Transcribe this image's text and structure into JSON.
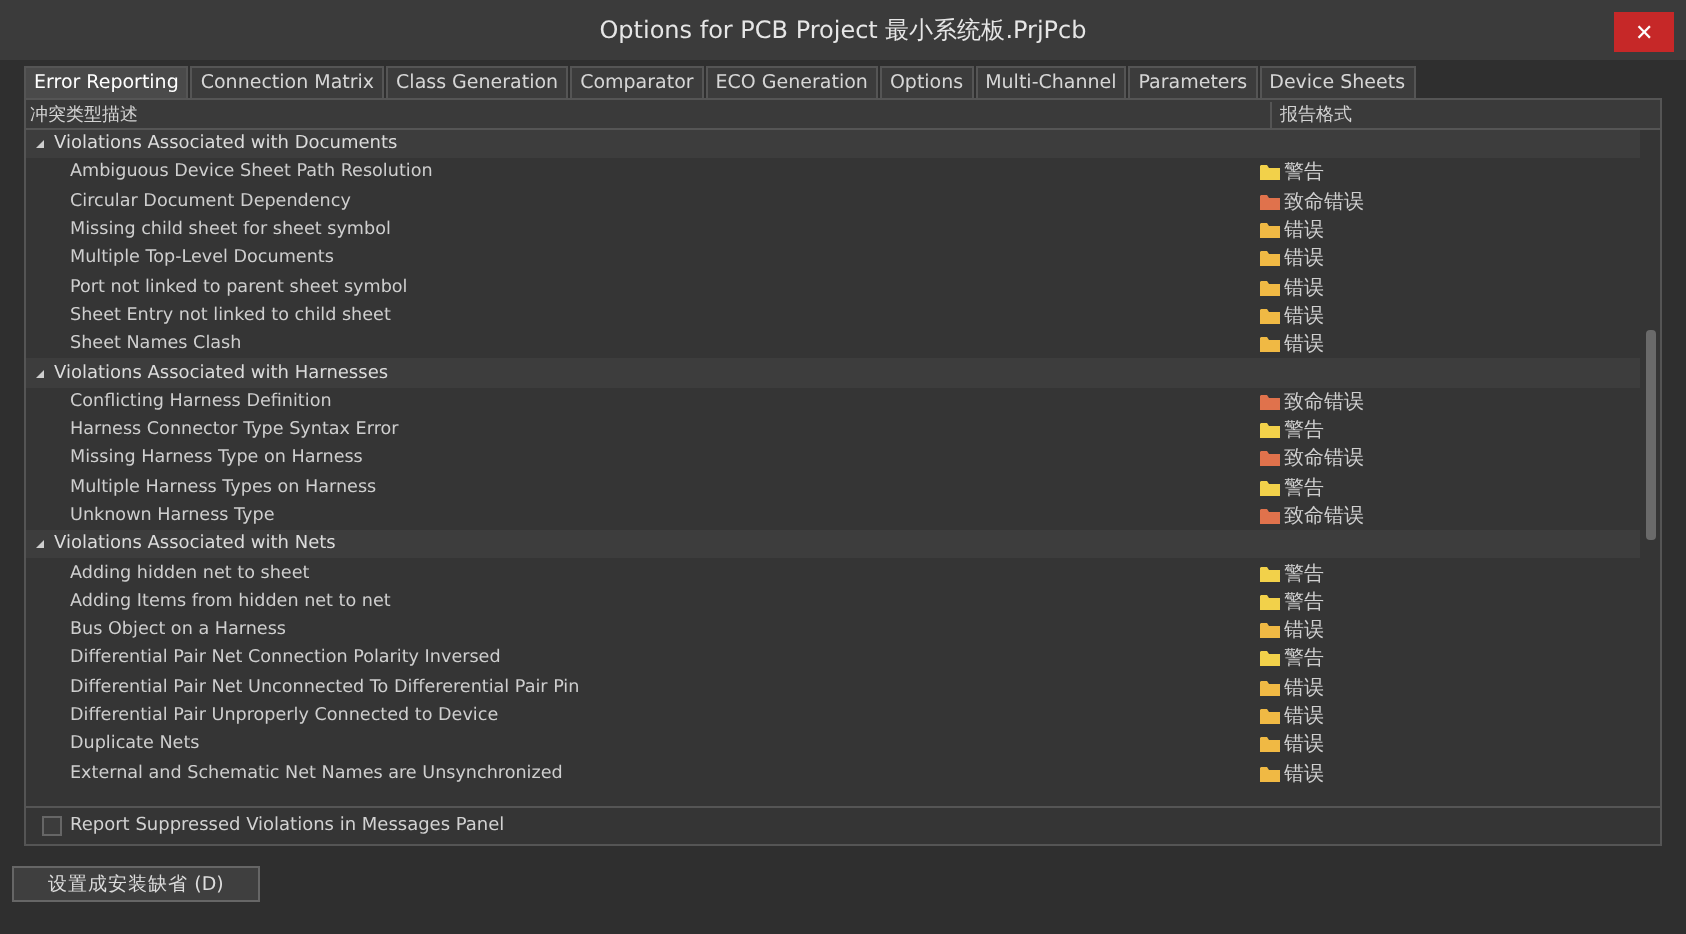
{
  "window": {
    "title": "Options for PCB Project 最小系统板.PrjPcb",
    "close": "✕"
  },
  "tabs": [
    {
      "label": "Error Reporting",
      "selected": true
    },
    {
      "label": "Connection Matrix",
      "selected": false
    },
    {
      "label": "Class Generation",
      "selected": false
    },
    {
      "label": "Comparator",
      "selected": false
    },
    {
      "label": "ECO Generation",
      "selected": false
    },
    {
      "label": "Options",
      "selected": false
    },
    {
      "label": "Multi-Channel",
      "selected": false
    },
    {
      "label": "Parameters",
      "selected": false
    },
    {
      "label": "Device Sheets",
      "selected": false
    }
  ],
  "table": {
    "columns": [
      "冲突类型描述",
      "报告格式"
    ],
    "groups": [
      {
        "label": "Violations Associated with Documents",
        "expanded": true,
        "children": [
          {
            "label": "Ambiguous Device Sheet Path Resolution",
            "report": "警告",
            "color": "#f2d14a"
          },
          {
            "label": "Circular Document Dependency",
            "report": "致命错误",
            "color": "#e0724c"
          },
          {
            "label": "Missing child sheet for sheet symbol",
            "report": "错误",
            "color": "#f0b944"
          },
          {
            "label": "Multiple Top-Level Documents",
            "report": "错误",
            "color": "#f0b944"
          },
          {
            "label": "Port not linked to parent sheet symbol",
            "report": "错误",
            "color": "#f0b944"
          },
          {
            "label": "Sheet Entry not linked to child sheet",
            "report": "错误",
            "color": "#f0b944"
          },
          {
            "label": "Sheet Names Clash",
            "report": "错误",
            "color": "#f0b944"
          }
        ]
      },
      {
        "label": "Violations Associated with Harnesses",
        "expanded": true,
        "children": [
          {
            "label": "Conflicting Harness Definition",
            "report": "致命错误",
            "color": "#e0724c"
          },
          {
            "label": "Harness Connector Type Syntax Error",
            "report": "警告",
            "color": "#f2d14a"
          },
          {
            "label": "Missing Harness Type on Harness",
            "report": "致命错误",
            "color": "#e0724c"
          },
          {
            "label": "Multiple Harness Types on Harness",
            "report": "警告",
            "color": "#f2d14a"
          },
          {
            "label": "Unknown Harness Type",
            "report": "致命错误",
            "color": "#e0724c"
          }
        ]
      },
      {
        "label": "Violations Associated with Nets",
        "expanded": true,
        "children": [
          {
            "label": "Adding hidden net to sheet",
            "report": "警告",
            "color": "#f2d14a"
          },
          {
            "label": "Adding Items from hidden net to net",
            "report": "警告",
            "color": "#f2d14a"
          },
          {
            "label": "Bus Object on a Harness",
            "report": "错误",
            "color": "#f0b944"
          },
          {
            "label": "Differential Pair Net Connection Polarity Inversed",
            "report": "警告",
            "color": "#f2d14a"
          },
          {
            "label": "Differential Pair Net Unconnected To Differerential Pair Pin",
            "report": "错误",
            "color": "#f0b944"
          },
          {
            "label": "Differential Pair Unproperly Connected to Device",
            "report": "错误",
            "color": "#f0b944"
          },
          {
            "label": "Duplicate Nets",
            "report": "错误",
            "color": "#f0b944"
          },
          {
            "label": "External and Schematic Net Names are Unsynchronized",
            "report": "错误",
            "color": "#f0b944"
          }
        ]
      }
    ]
  },
  "report_suppressed": {
    "label": "Report Suppressed Violations in Messages Panel",
    "checked": false
  },
  "buttons": [
    "设置成安装缺省 (D)"
  ]
}
